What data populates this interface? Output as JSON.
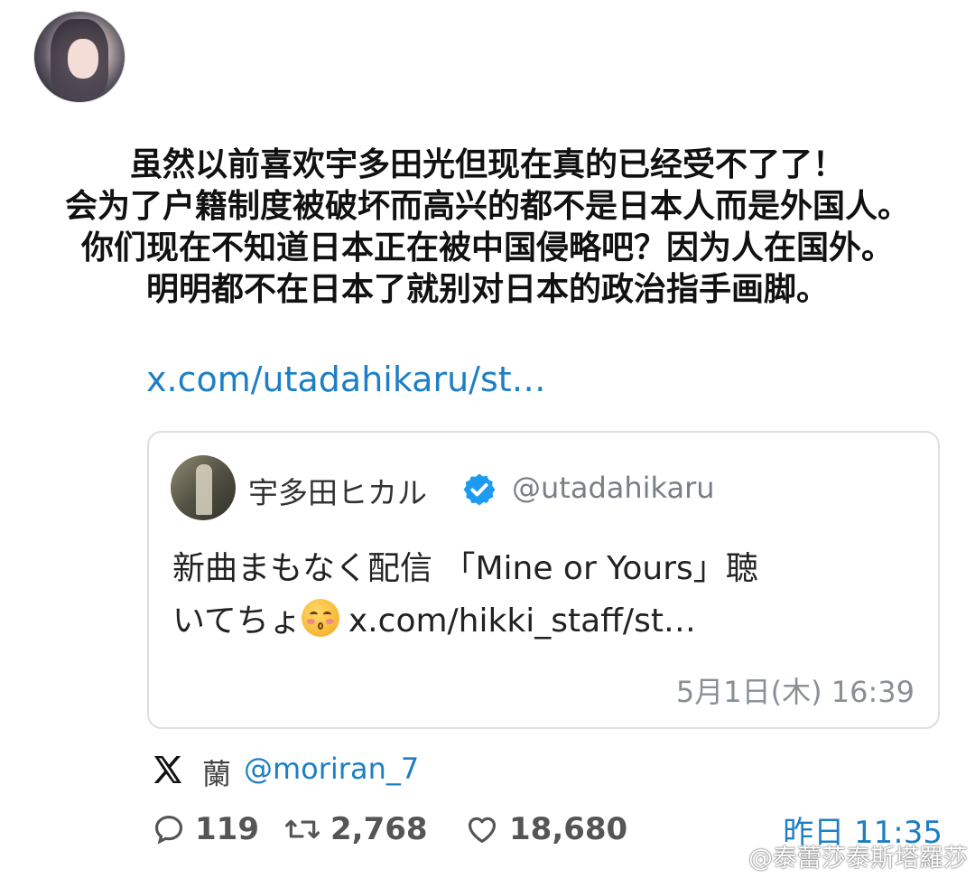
{
  "post": {
    "avatar_icon": "user-avatar",
    "lines": [
      "虽然以前喜欢宇多田光但现在真的已经受不了了！",
      "会为了户籍制度被破坏而高兴的都不是日本人而是外国人。",
      "你们现在不知道日本正在被中国侵略吧？因为人在国外。",
      "明明都不在日本了就别对日本的政治指手画脚。"
    ],
    "link": "x.com/utadahikaru/st…",
    "author_name": "蘭",
    "author_handle": "@moriran_7",
    "stats": {
      "replies": "119",
      "reposts": "2,768",
      "likes": "18,680"
    },
    "time": "昨日 11:35"
  },
  "quote": {
    "name": "宇多田ヒカル",
    "verified_icon": "verified-badge-icon",
    "handle": "@utadahikaru",
    "body_line1": "新曲まもなく配信 「Mine or Yours」聴",
    "body_line2_text": "いてちょ",
    "body_line2_link": "x.com/hikki_staff/st…",
    "emoji_icon": "kissing-face-emoji",
    "time": "5月1日(木) 16:39"
  },
  "watermark": "@泰蕾莎泰斯塔羅莎",
  "colors": {
    "link": "#1d7fc4",
    "verified": "#1d9bf0",
    "muted": "#8a8f95"
  }
}
